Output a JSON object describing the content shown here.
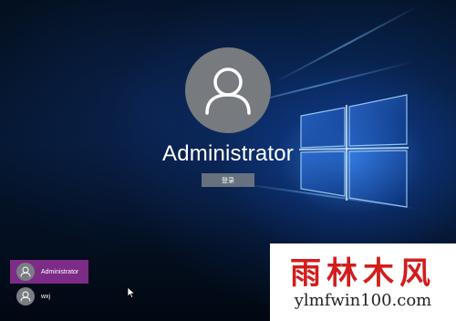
{
  "login": {
    "username": "Administrator",
    "signin_button": "登录"
  },
  "users": [
    {
      "name": "Administrator",
      "selected": true
    },
    {
      "name": "wxj",
      "selected": false
    }
  ],
  "watermark": {
    "title": "雨林木风",
    "url": "ylmfwin100.com"
  },
  "icons": {
    "avatar": "user-silhouette-icon",
    "cursor": "mouse-pointer-icon",
    "wallpaper_logo": "windows-logo-icon"
  },
  "colors": {
    "selected_tile": "#7c2b86",
    "avatar_bg": "#777a7f",
    "button_bg": "#787e86",
    "watermark_red": "#d21d1d"
  }
}
